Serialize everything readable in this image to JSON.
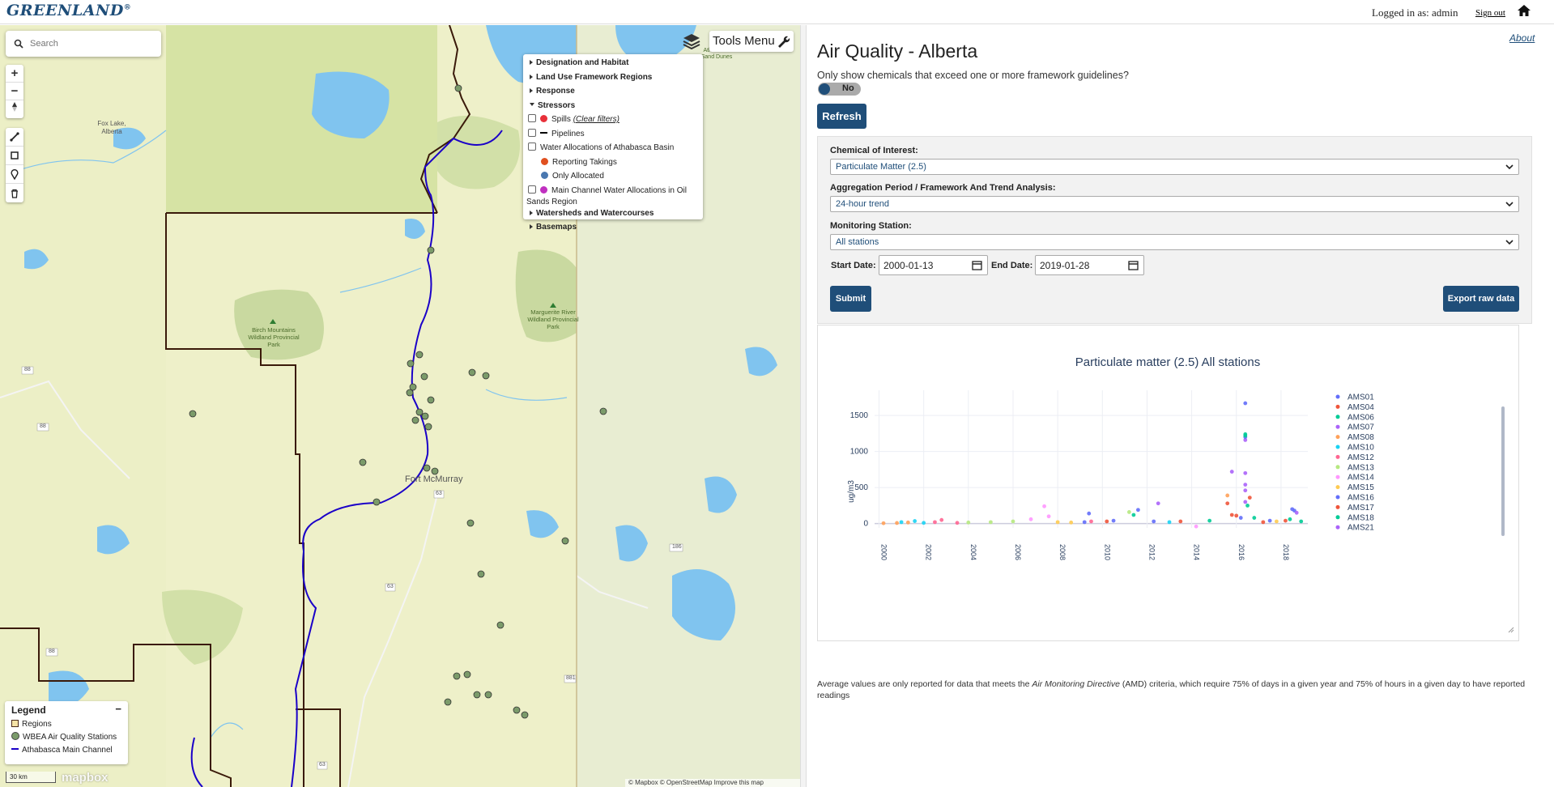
{
  "header": {
    "brand": "GREENLAND",
    "brand_mark": "®",
    "logged_in": "Logged in as: admin",
    "sign_out": "Sign out"
  },
  "map": {
    "search_placeholder": "Search",
    "tools_menu": "Tools Menu",
    "place_labels": {
      "fox_lake": "Fox Lake, Alberta",
      "birch": "Birch Mountains Wildland Provincial Park",
      "marguerite": "Marguerite River Wildland Provincial Park",
      "fort_mcmurray": "Fort McMurray",
      "athabasca": "Athabasca Sand Dunes",
      "road_88": "88",
      "road_63": "63",
      "road_881": "881",
      "road_186": "186"
    },
    "layers": {
      "designation": "Designation and Habitat",
      "land_use": "Land Use Framework Regions",
      "response": "Response",
      "stressors": "Stressors",
      "spills": "Spills",
      "clear_filters": "(Clear filters)",
      "pipelines": "Pipelines",
      "water_alloc": "Water Allocations of Athabasca Basin",
      "reporting_takings": "Reporting Takings",
      "only_allocated": "Only Allocated",
      "main_channel": "Main Channel Water Allocations in Oil Sands Region",
      "watersheds": "Watersheds and Watercourses",
      "basemaps": "Basemaps"
    },
    "legend": {
      "title": "Legend",
      "minimize": "−",
      "regions": "Regions",
      "stations": "WBEA Air Quality Stations",
      "channel": "Athabasca Main Channel"
    },
    "scale": "30 km",
    "mapbox_logo": "mapbox",
    "attribution": "© Mapbox © OpenStreetMap Improve this map",
    "colors": {
      "spills": "#e8303a",
      "reporting": "#e05020",
      "allocated": "#4a78b0",
      "main_channel": "#c030c0",
      "river": "#1a00c8",
      "boundary": "#3a1a0a"
    }
  },
  "panel": {
    "about": "About",
    "title": "Air Quality - Alberta",
    "subtitle": "Only show chemicals that exceed one or more framework guidelines?",
    "toggle_label": "No",
    "refresh": "Refresh",
    "chem_label": "Chemical of Interest:",
    "chem_value": "Particulate Matter (2.5)",
    "agg_label": "Aggregation Period / Framework And Trend Analysis:",
    "agg_value": "24-hour trend",
    "station_label": "Monitoring Station:",
    "station_value": "All stations",
    "start_label": "Start Date:",
    "start_value": "2000-01-13",
    "end_label": "End Date:",
    "end_value": "2019-01-28",
    "submit": "Submit",
    "export": "Export raw data",
    "note_pre": "Average values are only reported for data that meets the ",
    "note_em": "Air Monitoring Directive",
    "note_post": " (AMD) criteria, which require 75% of days in a given year and 75% of hours in a given day to have reported readings"
  },
  "chart_data": {
    "type": "scatter",
    "title": "Particulate matter (2.5) All stations",
    "xlabel": "",
    "ylabel": "ug/m3",
    "xlim": [
      1999.8,
      2019.2
    ],
    "ylim": [
      -60,
      1850
    ],
    "xticks": [
      "2000",
      "2002",
      "2004",
      "2006",
      "2008",
      "2010",
      "2012",
      "2014",
      "2016",
      "2018"
    ],
    "yticks": [
      "0",
      "500",
      "1000",
      "1500"
    ],
    "grid": true,
    "legend_position": "right",
    "series": [
      {
        "name": "AMS01",
        "color": "#636efa",
        "points": [
          [
            2009.2,
            20
          ],
          [
            2010.5,
            40
          ],
          [
            2012.3,
            30
          ],
          [
            2016.4,
            1670
          ],
          [
            2016.2,
            80
          ],
          [
            2017.5,
            40
          ],
          [
            2018.6,
            180
          ]
        ]
      },
      {
        "name": "AMS04",
        "color": "#ef553b",
        "points": [
          [
            2010.2,
            30
          ],
          [
            2013.5,
            30
          ],
          [
            2015.6,
            280
          ],
          [
            2016.0,
            110
          ],
          [
            2017.2,
            20
          ]
        ]
      },
      {
        "name": "AMS06",
        "color": "#00cc96",
        "points": [
          [
            2011.4,
            120
          ],
          [
            2014.8,
            40
          ],
          [
            2016.4,
            1240
          ],
          [
            2016.5,
            250
          ],
          [
            2018.4,
            60
          ]
        ]
      },
      {
        "name": "AMS07",
        "color": "#ab63fa",
        "points": [
          [
            2012.5,
            280
          ],
          [
            2015.8,
            720
          ],
          [
            2016.4,
            700
          ],
          [
            2016.4,
            540
          ],
          [
            2016.4,
            1160
          ]
        ]
      },
      {
        "name": "AMS08",
        "color": "#ffa15a",
        "points": [
          [
            2000.2,
            5
          ],
          [
            2000.8,
            8
          ],
          [
            2001.3,
            15
          ],
          [
            2015.6,
            390
          ]
        ]
      },
      {
        "name": "AMS10",
        "color": "#19d3f3",
        "points": [
          [
            2001.0,
            20
          ],
          [
            2001.6,
            35
          ],
          [
            2002.0,
            10
          ],
          [
            2013.0,
            20
          ]
        ]
      },
      {
        "name": "AMS12",
        "color": "#ff6692",
        "points": [
          [
            2002.5,
            20
          ],
          [
            2002.8,
            50
          ],
          [
            2003.5,
            10
          ],
          [
            2009.5,
            30
          ]
        ]
      },
      {
        "name": "AMS13",
        "color": "#b6e880",
        "points": [
          [
            2004.0,
            15
          ],
          [
            2005.0,
            20
          ],
          [
            2006.0,
            30
          ],
          [
            2011.2,
            160
          ]
        ]
      },
      {
        "name": "AMS14",
        "color": "#ff97ff",
        "points": [
          [
            2006.8,
            60
          ],
          [
            2007.4,
            240
          ],
          [
            2007.6,
            100
          ],
          [
            2014.2,
            -40
          ]
        ]
      },
      {
        "name": "AMS15",
        "color": "#fecb52",
        "points": [
          [
            2008.0,
            20
          ],
          [
            2008.6,
            15
          ],
          [
            2017.8,
            30
          ]
        ]
      },
      {
        "name": "AMS16",
        "color": "#636efa",
        "points": [
          [
            2009.4,
            140
          ],
          [
            2011.6,
            190
          ],
          [
            2016.4,
            1200
          ],
          [
            2018.5,
            200
          ]
        ]
      },
      {
        "name": "AMS17",
        "color": "#ef553b",
        "points": [
          [
            2015.8,
            120
          ],
          [
            2016.6,
            360
          ],
          [
            2018.2,
            40
          ]
        ]
      },
      {
        "name": "AMS18",
        "color": "#00cc96",
        "points": [
          [
            2016.4,
            1220
          ],
          [
            2016.8,
            80
          ],
          [
            2018.9,
            30
          ]
        ]
      },
      {
        "name": "AMS21",
        "color": "#ab63fa",
        "points": [
          [
            2016.4,
            460
          ],
          [
            2016.4,
            300
          ],
          [
            2018.7,
            150
          ]
        ]
      }
    ]
  }
}
